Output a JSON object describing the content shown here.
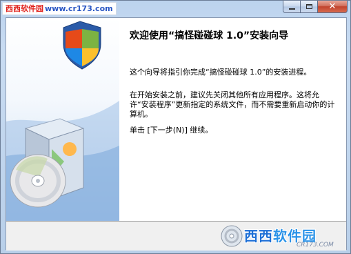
{
  "watermark": {
    "part1": "西西软件园",
    "part2": "www.cr173.com"
  },
  "window": {
    "close_glyph": "✕"
  },
  "wizard": {
    "title": "欢迎使用“搞怪碰碰球 1.0”安装向导",
    "para1": "这个向导将指引你完成“搞怪碰碰球 1.0”的安装进程。",
    "para2": "在开始安装之前，建议先关闭其他所有应用程序。这将允许“安装程序”更新指定的系统文件，而不需要重新启动你的计算机。",
    "para3": "单击 [下一步(N)] 继续。"
  },
  "logo": {
    "text1": "西西",
    "text2": "软件园",
    "sub": "CR173.COM"
  },
  "colors": {
    "accent": "#1d6fd6",
    "close": "#c0432d",
    "frame": "#bcd3ee"
  },
  "icons": [
    "windows-shield-icon",
    "software-box-icon",
    "cd-disc-icon",
    "logo-disc-icon",
    "minimize-icon",
    "maximize-icon",
    "close-icon"
  ]
}
